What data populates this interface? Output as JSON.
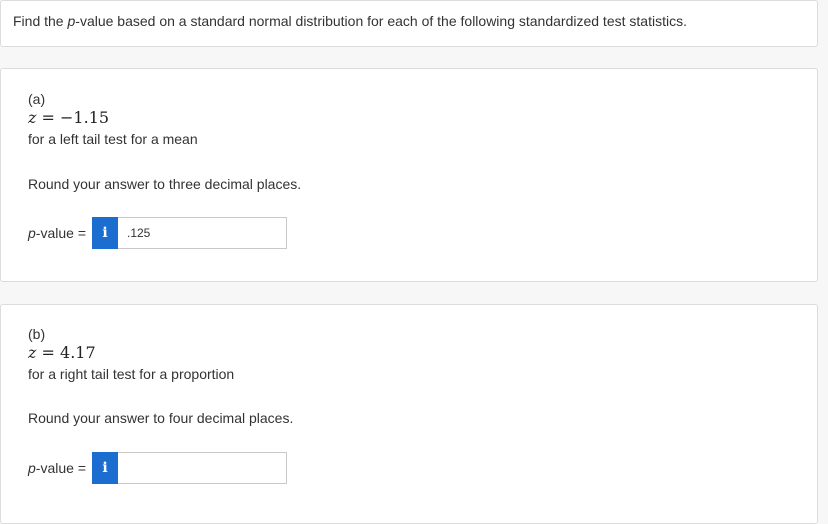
{
  "intro": {
    "text_before": "Find the ",
    "text_italic": "p",
    "text_after": "-value based on a standard normal distribution for each of the following standardized test statistics."
  },
  "parts": [
    {
      "label": "(a)",
      "z_var": "z",
      "z_eq": " = −1.15",
      "description": "for a left tail test for a mean",
      "instruction": "Round your answer to three decimal places.",
      "pvalue_italic": "p",
      "pvalue_rest": "-value =",
      "info_icon": "i",
      "answer": ".125",
      "answer_placeholder": ""
    },
    {
      "label": "(b)",
      "z_var": "z",
      "z_eq": " = 4.17",
      "description": "for a right tail test for a proportion",
      "instruction": "Round your answer to four decimal places.",
      "pvalue_italic": "p",
      "pvalue_rest": "-value =",
      "info_icon": "i",
      "answer": "",
      "answer_placeholder": ""
    }
  ],
  "colors": {
    "info_button": "#1b6ed0",
    "card_border": "#dcdcdc",
    "background": "#f7f7f7"
  }
}
